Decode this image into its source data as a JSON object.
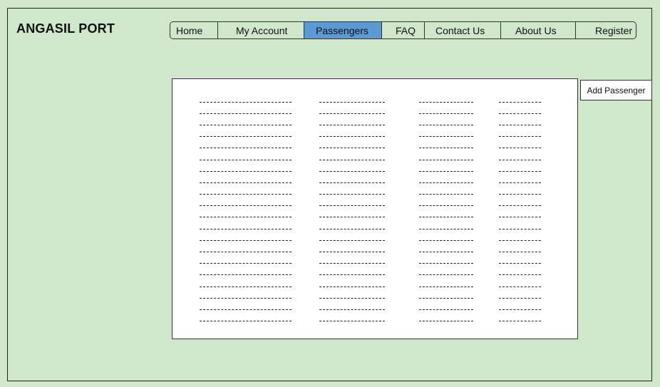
{
  "app": {
    "title": "ANGASIL PORT"
  },
  "nav": {
    "items": [
      {
        "label": "Home",
        "active": false
      },
      {
        "label": "My Account",
        "active": false
      },
      {
        "label": "Passengers",
        "active": true
      },
      {
        "label": "FAQ",
        "active": false
      },
      {
        "label": "Contact Us",
        "active": false
      },
      {
        "label": "About Us",
        "active": false
      },
      {
        "label": "Register",
        "active": false
      }
    ],
    "active_color": "#5a9bd5"
  },
  "passengers_list": {
    "columns": 4,
    "rows_per_column": 20
  },
  "actions": {
    "add_passenger_label": "Add Passenger"
  },
  "colors": {
    "background": "#d0e7cc",
    "panel": "#ffffff"
  }
}
